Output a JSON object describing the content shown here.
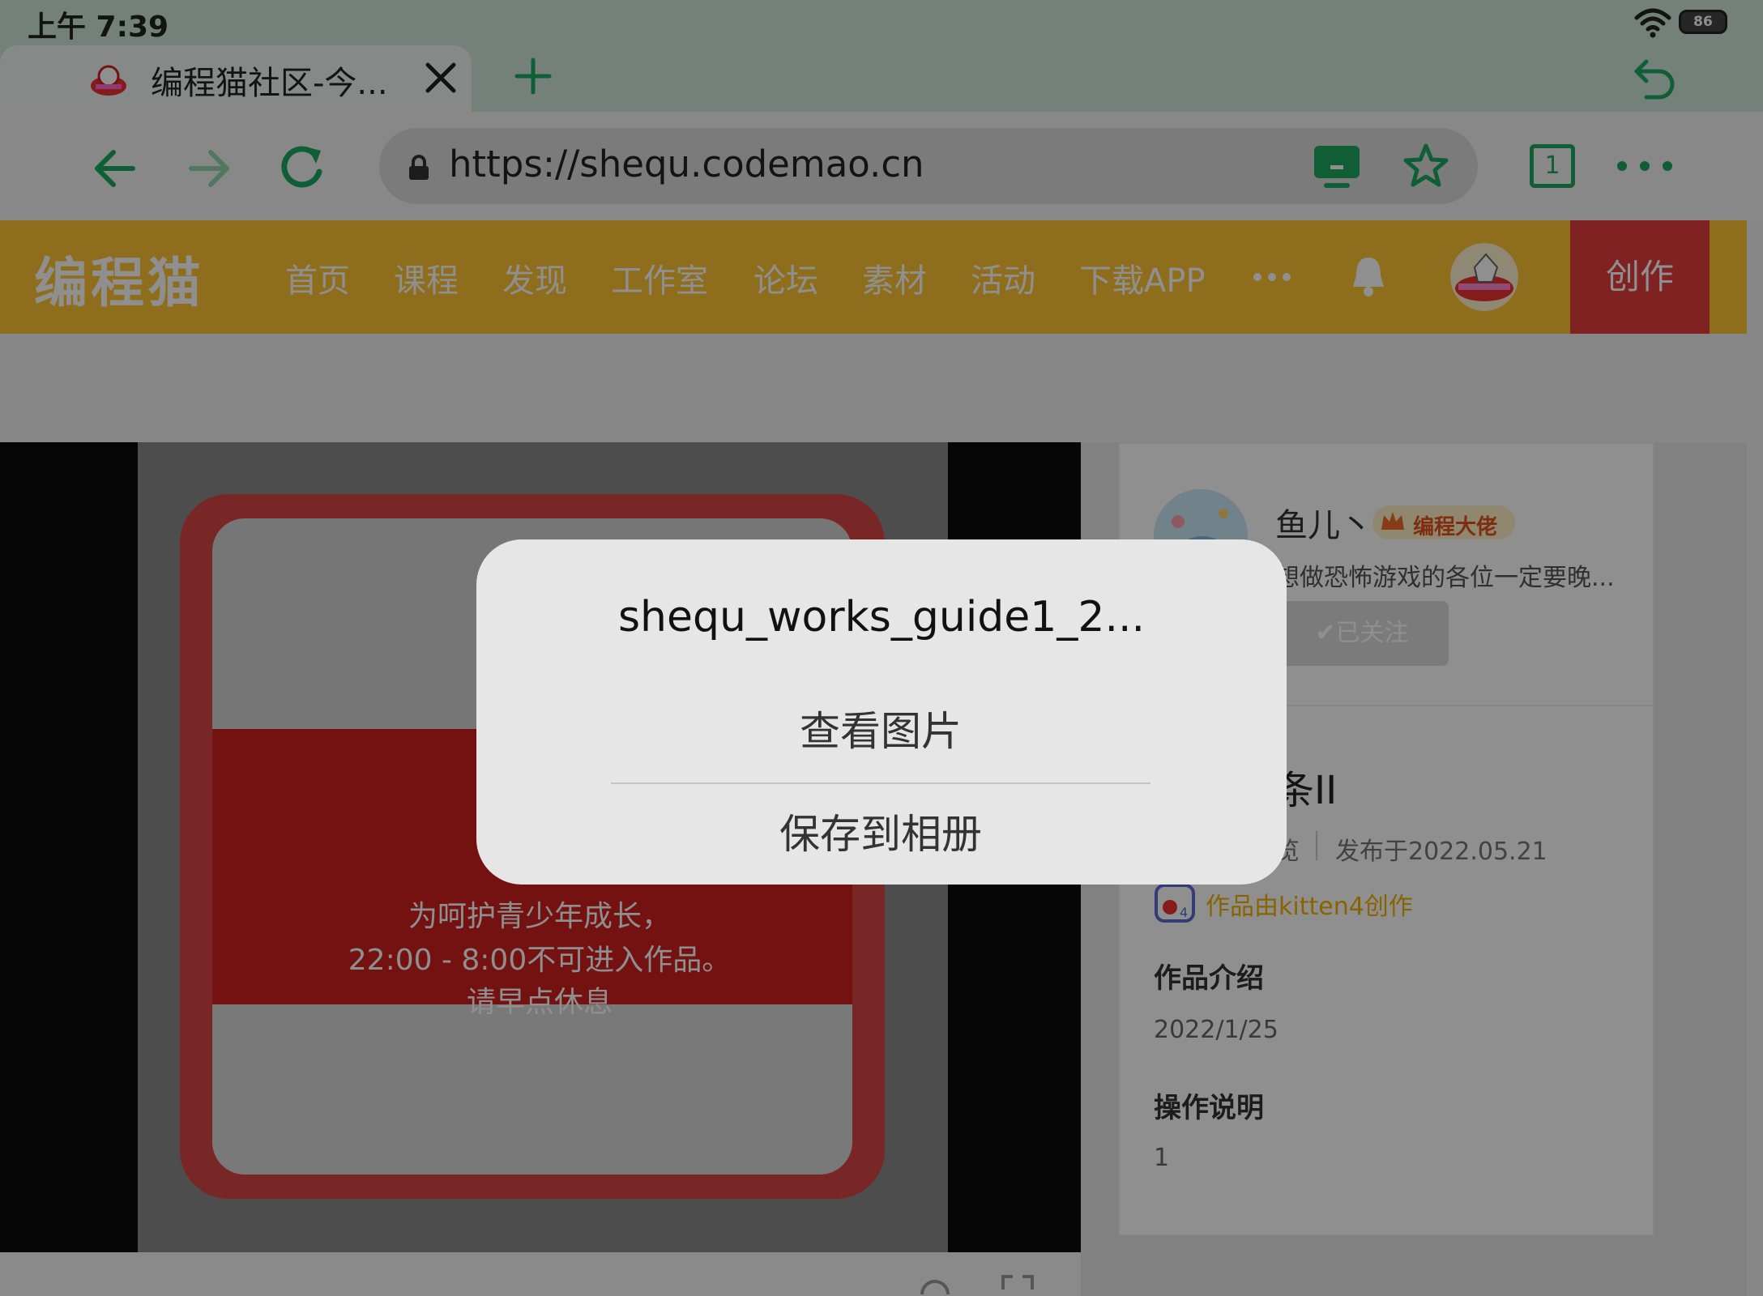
{
  "status_bar": {
    "time": "上午 7:39",
    "battery": "86"
  },
  "tab": {
    "title": "编程猫社区-今...",
    "close_icon": "close-icon"
  },
  "address_bar": {
    "url": "https://shequ.codemao.cn",
    "tab_count": "1"
  },
  "site": {
    "logo": "编程猫",
    "nav": [
      "首页",
      "课程",
      "发现",
      "工作室",
      "论坛",
      "素材",
      "活动",
      "下载APP"
    ],
    "create_label": "创作",
    "brand_color": "#fec433",
    "create_color": "#e43e3e"
  },
  "player": {
    "messages": [
      "为呵护青少年成长，",
      "22:00 - 8:00不可进入作品。",
      "请早点休息"
    ]
  },
  "author": {
    "name": "鱼儿丶",
    "badge": "编程大佬",
    "bio": "想做恐怖游戏的各位一定要晚...",
    "follow_label": "✔已关注"
  },
  "work": {
    "title": "条II",
    "views": "览",
    "date": "发布于2022.05.21",
    "made_with": "作品由kitten4创作",
    "intro_heading": "作品介绍",
    "intro_text": "2022/1/25",
    "ops_heading": "操作说明",
    "ops_text": "1"
  },
  "dialog": {
    "title": "shequ_works_guide1_2...",
    "view_image": "查看图片",
    "save_to_album": "保存到相册"
  },
  "accent_color": "#1ba85f"
}
